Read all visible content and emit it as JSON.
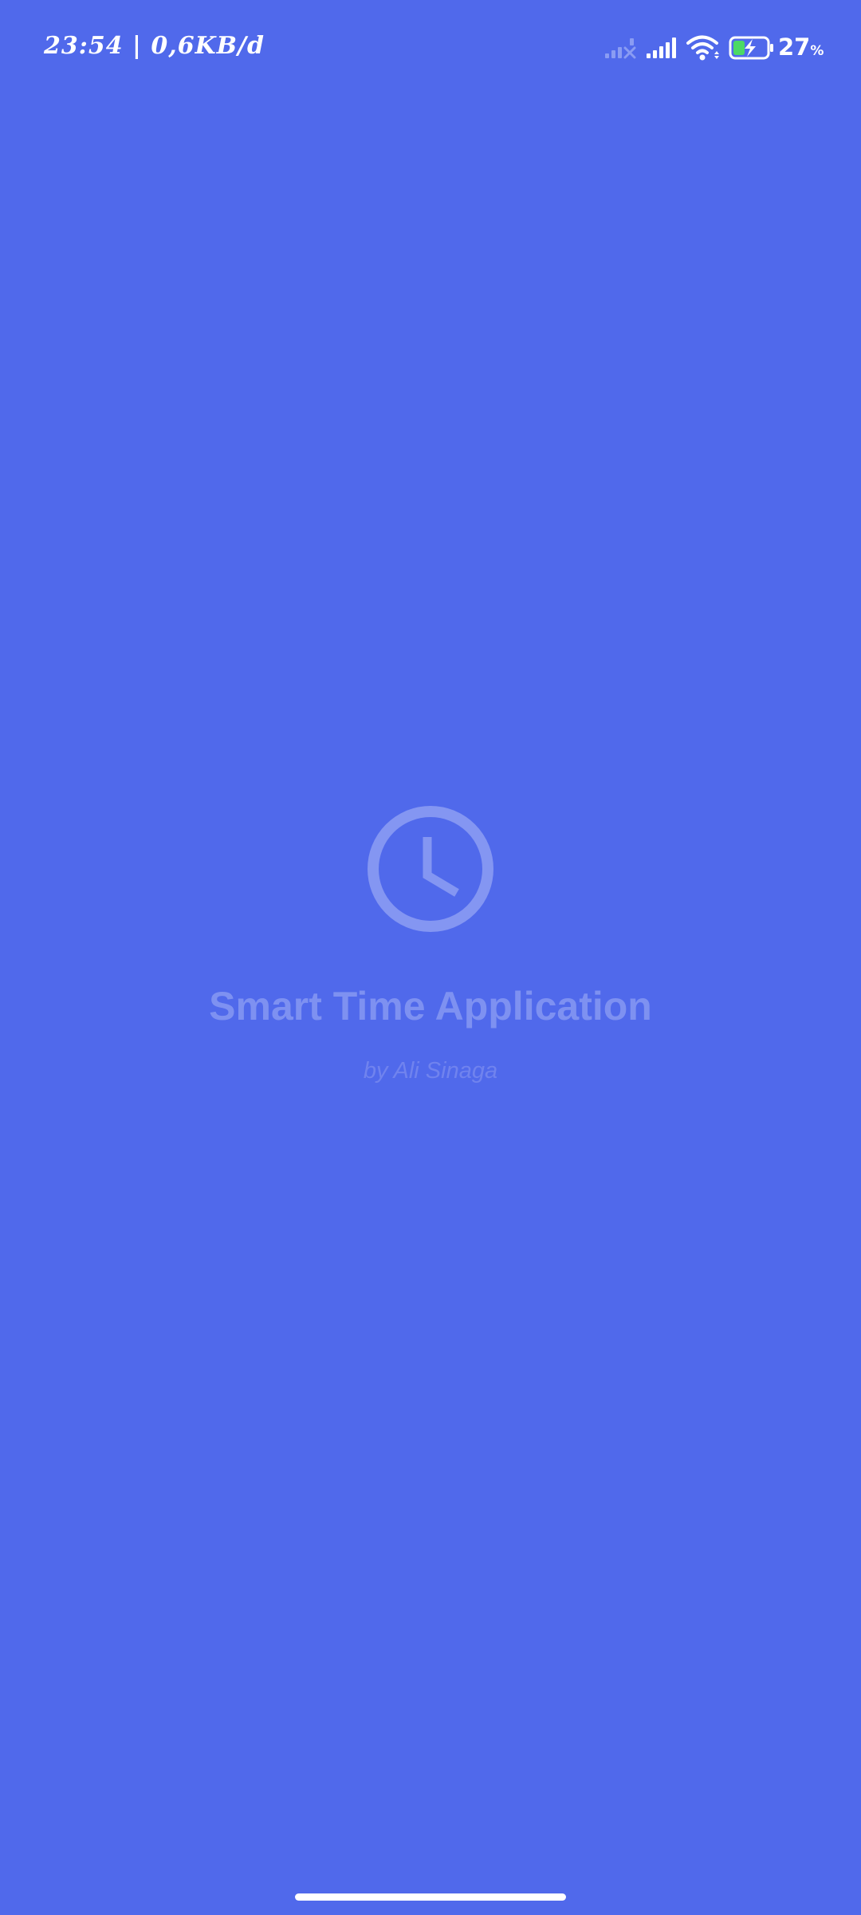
{
  "status_bar": {
    "time": "23:54",
    "separator": "|",
    "data_rate": "0,6KB/d",
    "battery_level": "27",
    "battery_unit": "%",
    "icons": [
      "signal-disabled-icon",
      "signal-icon",
      "wifi-icon",
      "battery-charging-icon"
    ]
  },
  "app": {
    "title": "Smart Time Application",
    "author": "by Ali Sinaga",
    "icon": "clock-icon"
  },
  "colors": {
    "background": "#5069EB",
    "title": "#7E91F1",
    "author": "#7083EE",
    "icon": "#8496F2",
    "battery_fill": "#4CD964"
  }
}
